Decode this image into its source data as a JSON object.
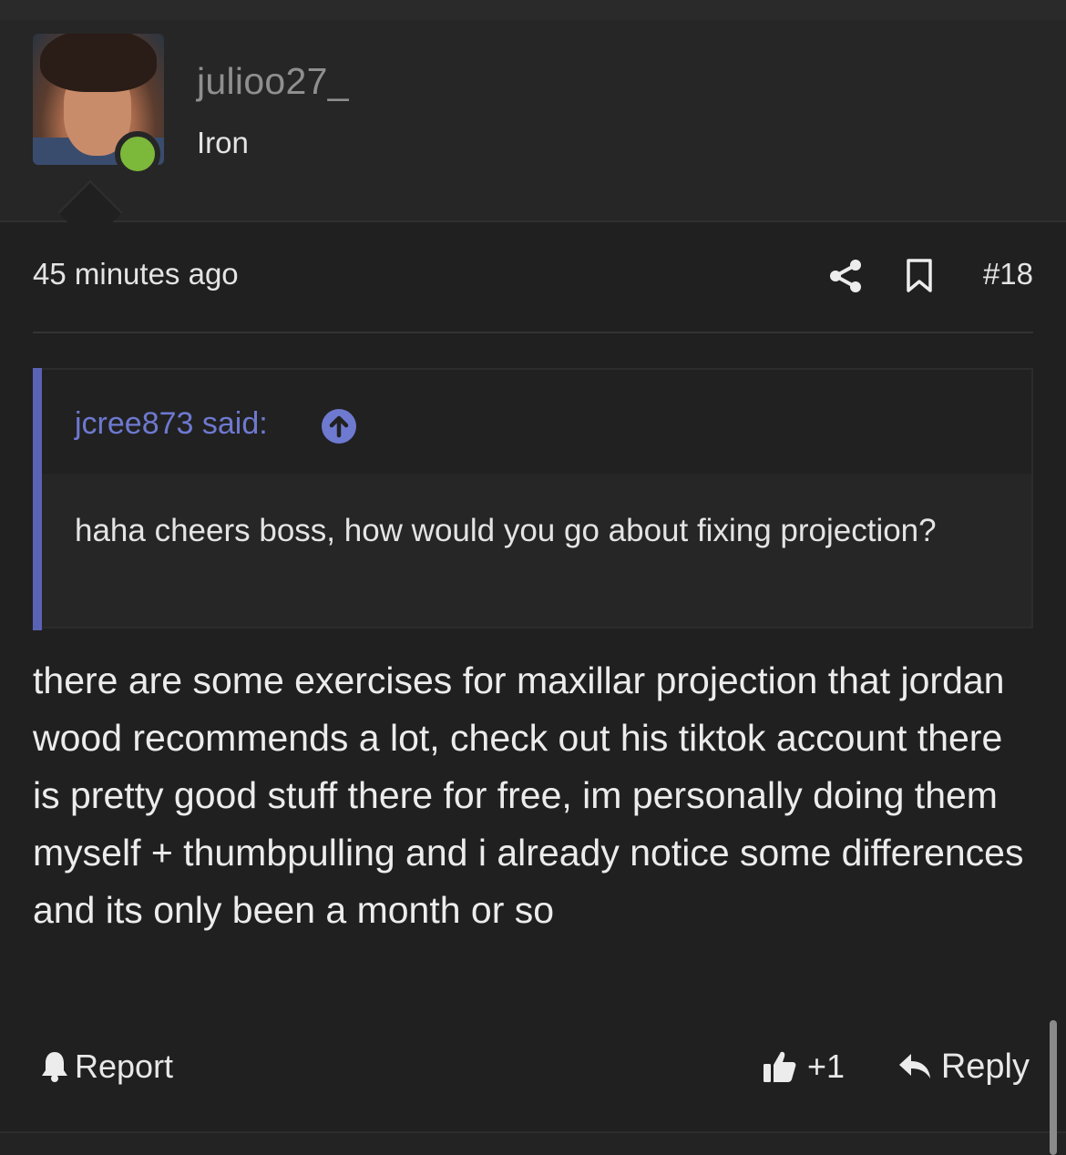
{
  "user": {
    "username": "julioo27_",
    "rank": "Iron",
    "online": true
  },
  "post": {
    "time": "45 minutes ago",
    "number": "#18",
    "body": "there are some exercises for maxillar projection that jordan wood recommends a lot, check out his tiktok account there is pretty good stuff there for free, im personally doing them myself + thumbpulling and i already notice some differences and its only been a month or so"
  },
  "quote": {
    "author_label": "jcree873 said:",
    "text": "haha cheers boss, how would you go about fixing projection?"
  },
  "actions": {
    "report_label": "Report",
    "like_count": "+1",
    "reply_label": "Reply"
  },
  "icons": {
    "share": "share-icon",
    "bookmark": "bookmark-icon",
    "quote_jump": "arrow-up-circle-icon",
    "report": "bell-icon",
    "like": "thumbs-up-icon",
    "reply": "reply-arrow-icon"
  },
  "colors": {
    "background": "#202020",
    "quote_accent": "#5a62b6",
    "quote_author": "#6e79d0",
    "online": "#7cb83a",
    "username": "#8f8f8f"
  }
}
